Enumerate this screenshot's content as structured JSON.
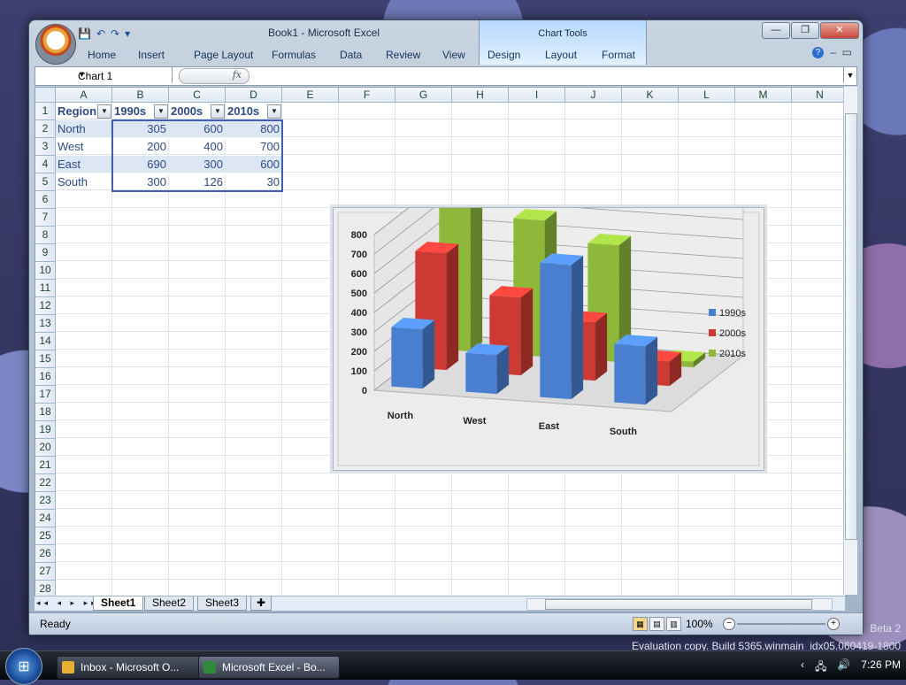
{
  "window": {
    "title": "Book1 - Microsoft Excel",
    "contextual_group": "Chart Tools",
    "controls": [
      "—",
      "❐",
      "✕"
    ]
  },
  "qat": {
    "save": "💾",
    "undo": "↶",
    "redo": "↷",
    "customize": "▾"
  },
  "ribbon": {
    "tabs": [
      "Home",
      "Insert",
      "Page Layout",
      "Formulas",
      "Data",
      "Review",
      "View",
      "Design",
      "Layout",
      "Format"
    ],
    "help": "?",
    "minimize": "–",
    "restore": "▭"
  },
  "formula_bar": {
    "name_box": "Chart 1",
    "fx": "fx",
    "content": ""
  },
  "sheet": {
    "columns": [
      "A",
      "B",
      "C",
      "D",
      "E",
      "F",
      "G",
      "H",
      "I",
      "J",
      "K",
      "L",
      "M",
      "N"
    ],
    "rows": [
      "1",
      "2",
      "3",
      "4",
      "5",
      "6",
      "7",
      "8",
      "9",
      "10",
      "11",
      "12",
      "13",
      "14",
      "15",
      "16",
      "17",
      "18",
      "19",
      "20",
      "21",
      "22",
      "23",
      "24",
      "25",
      "26",
      "27",
      "28"
    ],
    "table": {
      "headers": [
        "Region",
        "1990s",
        "2000s",
        "2010s"
      ],
      "data": [
        [
          "North",
          "305",
          "600",
          "800"
        ],
        [
          "West",
          "200",
          "400",
          "700"
        ],
        [
          "East",
          "690",
          "300",
          "600"
        ],
        [
          "South",
          "300",
          "126",
          "30"
        ]
      ]
    }
  },
  "chart_data": {
    "type": "bar",
    "categories": [
      "North",
      "West",
      "East",
      "South"
    ],
    "series": [
      {
        "name": "1990s",
        "values": [
          305,
          200,
          690,
          300
        ],
        "color": "#4a7fd0"
      },
      {
        "name": "2000s",
        "values": [
          600,
          400,
          300,
          126
        ],
        "color": "#cc3a33"
      },
      {
        "name": "2010s",
        "values": [
          800,
          700,
          600,
          30
        ],
        "color": "#8db83a"
      }
    ],
    "y_ticks": [
      "0",
      "100",
      "200",
      "300",
      "400",
      "500",
      "600",
      "700",
      "800"
    ],
    "ylim": [
      0,
      800
    ],
    "legend": "right",
    "grid": true
  },
  "sheet_tabs": [
    "Sheet1",
    "Sheet2",
    "Sheet3"
  ],
  "sheet_nav": "◂◂ ◂ ▸ ▸▸",
  "status": {
    "ready": "Ready",
    "zoom": "100%",
    "zoom_out": "−",
    "zoom_in": "+"
  },
  "watermark": {
    "line1": "Beta 2",
    "line2": "Evaluation copy. Build 5365.winmain_idx05.060419-1800"
  },
  "taskbar": {
    "tasks": [
      {
        "label": "Inbox - Microsoft O...",
        "color": "#e8b030"
      },
      {
        "label": "Microsoft Excel - Bo...",
        "color": "#2f8a3a"
      }
    ],
    "clock": "7:26 PM",
    "chevron": "‹",
    "net": "🖧",
    "volume": "🔊"
  }
}
